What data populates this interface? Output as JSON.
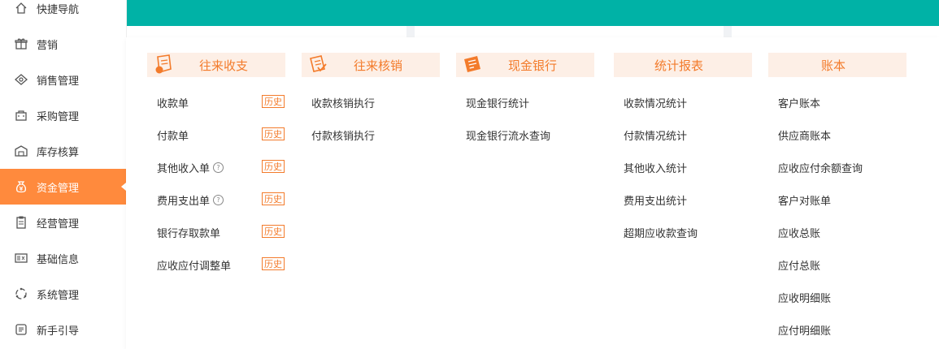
{
  "colors": {
    "accent": "#ff8a3d",
    "brand": "#00b2a6",
    "header_bg": "#fdefe6",
    "header_text": "#f37b2b"
  },
  "sidebar": {
    "items": [
      {
        "label": "快捷导航",
        "icon": "home-icon"
      },
      {
        "label": "营销",
        "icon": "gift-icon"
      },
      {
        "label": "销售管理",
        "icon": "sales-icon"
      },
      {
        "label": "采购管理",
        "icon": "bag-icon"
      },
      {
        "label": "库存核算",
        "icon": "warehouse-icon"
      },
      {
        "label": "资金管理",
        "icon": "money-bag-icon",
        "active": true
      },
      {
        "label": "经营管理",
        "icon": "clipboard-icon"
      },
      {
        "label": "基础信息",
        "icon": "id-card-icon"
      },
      {
        "label": "系统管理",
        "icon": "system-circle-icon"
      },
      {
        "label": "新手引导",
        "icon": "guide-icon"
      }
    ]
  },
  "menu": {
    "history_label": "历史",
    "columns": [
      {
        "title": "往来收支",
        "icon": "receipt-icon",
        "items": [
          {
            "label": "收款单",
            "history": true
          },
          {
            "label": "付款单",
            "history": true
          },
          {
            "label": "其他收入单",
            "help": "?",
            "history": true
          },
          {
            "label": "费用支出单",
            "help": "?",
            "history": true
          },
          {
            "label": "银行存取款单",
            "history": true
          },
          {
            "label": "应收应付调整单",
            "history": true
          }
        ]
      },
      {
        "title": "往来核销",
        "icon": "writeoff-icon",
        "items": [
          {
            "label": "收款核销执行"
          },
          {
            "label": "付款核销执行"
          }
        ]
      },
      {
        "title": "现金银行",
        "icon": "bank-icon",
        "items": [
          {
            "label": "现金银行统计"
          },
          {
            "label": "现金银行流水查询"
          }
        ]
      },
      {
        "title": "统计报表",
        "items": [
          {
            "label": "收款情况统计"
          },
          {
            "label": "付款情况统计"
          },
          {
            "label": "其他收入统计"
          },
          {
            "label": "费用支出统计"
          },
          {
            "label": "超期应收款查询"
          }
        ]
      },
      {
        "title": "账本",
        "items": [
          {
            "label": "客户账本"
          },
          {
            "label": "供应商账本"
          },
          {
            "label": "应收应付余额查询"
          },
          {
            "label": "客户对账单"
          },
          {
            "label": "应收总账"
          },
          {
            "label": "应付总账"
          },
          {
            "label": "应收明细账"
          },
          {
            "label": "应付明细账"
          }
        ]
      }
    ]
  }
}
